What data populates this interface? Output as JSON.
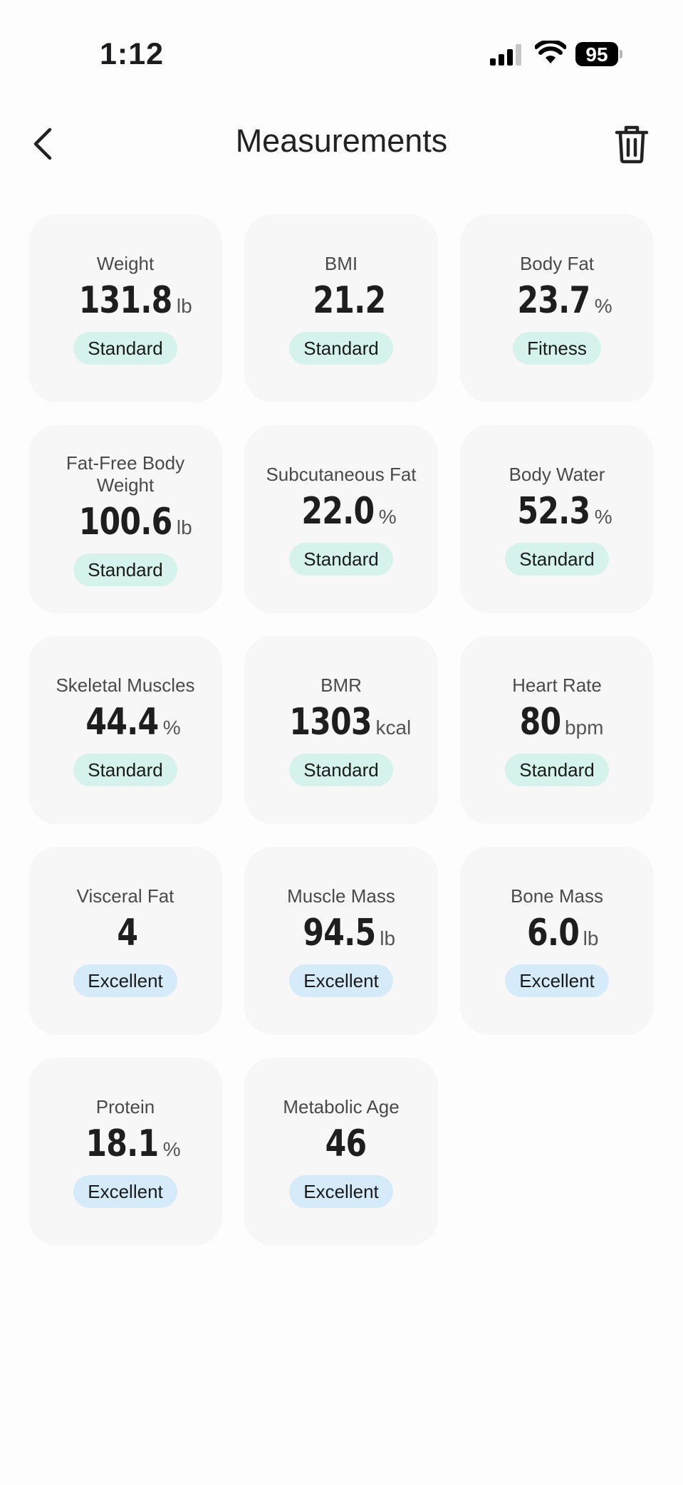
{
  "status_bar": {
    "time": "1:12",
    "battery": "95"
  },
  "nav": {
    "title": "Measurements",
    "back_icon": "chevron-left-icon",
    "trash_icon": "trash-icon"
  },
  "colors": {
    "standard_badge": "#d6f2ec",
    "excellent_badge": "#d6ebfa",
    "card_background": "#f7f7f7"
  },
  "metrics": [
    {
      "label": "Weight",
      "value": "131.8",
      "unit": "lb",
      "status": "Standard",
      "tone": "standard"
    },
    {
      "label": "BMI",
      "value": "21.2",
      "unit": "",
      "status": "Standard",
      "tone": "standard"
    },
    {
      "label": "Body Fat",
      "value": "23.7",
      "unit": "%",
      "status": "Fitness",
      "tone": "standard"
    },
    {
      "label": "Fat-Free Body Weight",
      "value": "100.6",
      "unit": "lb",
      "status": "Standard",
      "tone": "standard"
    },
    {
      "label": "Subcutaneous Fat",
      "value": "22.0",
      "unit": "%",
      "status": "Standard",
      "tone": "standard"
    },
    {
      "label": "Body Water",
      "value": "52.3",
      "unit": "%",
      "status": "Standard",
      "tone": "standard"
    },
    {
      "label": "Skeletal Muscles",
      "value": "44.4",
      "unit": "%",
      "status": "Standard",
      "tone": "standard"
    },
    {
      "label": "BMR",
      "value": "1303",
      "unit": "kcal",
      "status": "Standard",
      "tone": "standard"
    },
    {
      "label": "Heart Rate",
      "value": "80",
      "unit": "bpm",
      "status": "Standard",
      "tone": "standard"
    },
    {
      "label": "Visceral Fat",
      "value": "4",
      "unit": "",
      "status": "Excellent",
      "tone": "excellent"
    },
    {
      "label": "Muscle Mass",
      "value": "94.5",
      "unit": "lb",
      "status": "Excellent",
      "tone": "excellent"
    },
    {
      "label": "Bone Mass",
      "value": "6.0",
      "unit": "lb",
      "status": "Excellent",
      "tone": "excellent"
    },
    {
      "label": "Protein",
      "value": "18.1",
      "unit": "%",
      "status": "Excellent",
      "tone": "excellent"
    },
    {
      "label": "Metabolic Age",
      "value": "46",
      "unit": "",
      "status": "Excellent",
      "tone": "excellent"
    }
  ]
}
